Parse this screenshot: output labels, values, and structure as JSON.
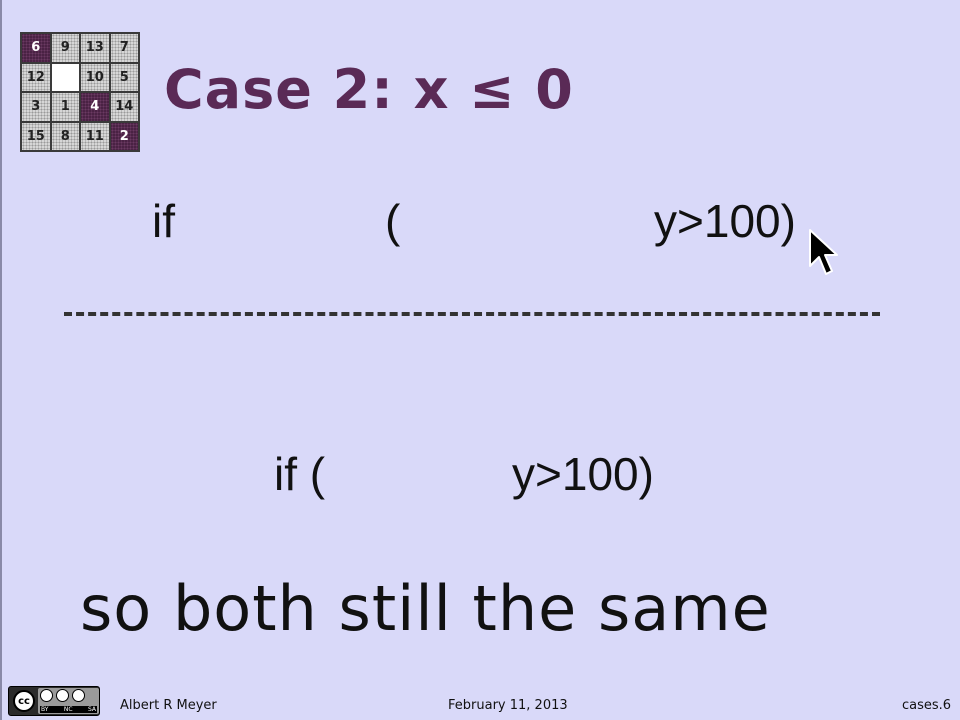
{
  "puzzle": {
    "tiles": [
      {
        "label": "6",
        "style": "dark"
      },
      {
        "label": "9",
        "style": "light"
      },
      {
        "label": "13",
        "style": "light"
      },
      {
        "label": "7",
        "style": "light"
      },
      {
        "label": "12",
        "style": "light"
      },
      {
        "label": "",
        "style": "empty"
      },
      {
        "label": "10",
        "style": "light"
      },
      {
        "label": "5",
        "style": "light"
      },
      {
        "label": "3",
        "style": "light"
      },
      {
        "label": "1",
        "style": "light"
      },
      {
        "label": "4",
        "style": "dark"
      },
      {
        "label": "14",
        "style": "light"
      },
      {
        "label": "15",
        "style": "light"
      },
      {
        "label": "8",
        "style": "light"
      },
      {
        "label": "11",
        "style": "light"
      },
      {
        "label": "2",
        "style": "dark"
      }
    ]
  },
  "slide": {
    "title": "Case 2: x ≤ 0",
    "line1": {
      "if": "if",
      "paren": "(",
      "cond": "y>100)"
    },
    "line2": {
      "if": "if (",
      "cond": "y>100)"
    },
    "conclusion": "so both still the same"
  },
  "footer": {
    "cc_label": "cc",
    "cc_terms": [
      "BY",
      "NC",
      "SA"
    ],
    "author": "Albert R Meyer",
    "date": "February 11, 2013",
    "slide_id": "cases.6"
  },
  "colors": {
    "background": "#d9d9f9",
    "title": "#5a2a56",
    "dark_tile": "#4a2244"
  },
  "icons": {
    "cursor": "mouse-pointer-icon"
  }
}
